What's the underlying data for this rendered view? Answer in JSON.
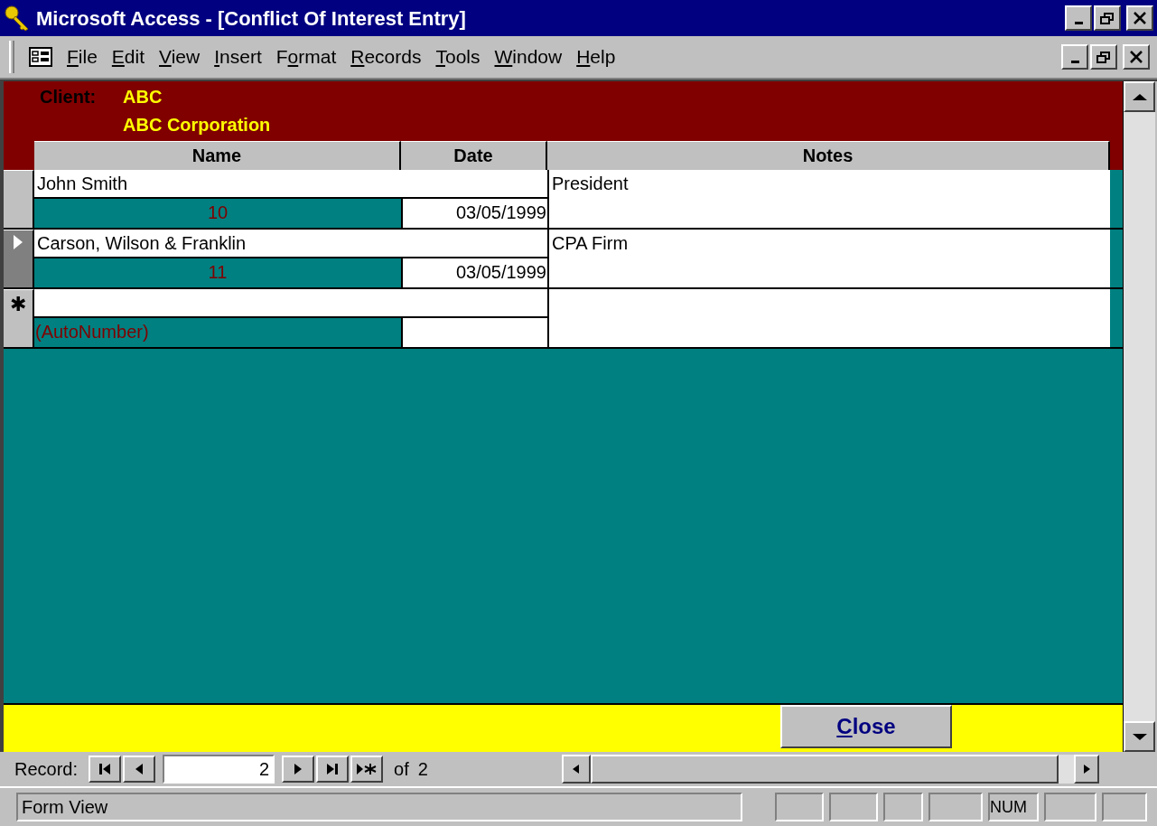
{
  "window": {
    "title": "Microsoft Access - [Conflict Of Interest Entry]"
  },
  "menu": [
    {
      "key": "F",
      "rest": "ile"
    },
    {
      "key": "E",
      "rest": "dit"
    },
    {
      "key": "V",
      "rest": "iew"
    },
    {
      "key": "I",
      "rest": "nsert"
    },
    {
      "pre": "F",
      "key": "o",
      "rest": "rmat"
    },
    {
      "key": "R",
      "rest": "ecords"
    },
    {
      "key": "T",
      "rest": "ools"
    },
    {
      "key": "W",
      "rest": "indow"
    },
    {
      "key": "H",
      "rest": "elp"
    }
  ],
  "form_header": {
    "client_label": "Client:",
    "client_code": "ABC",
    "client_name": "ABC Corporation"
  },
  "columns": [
    "Name",
    "Date",
    "Notes"
  ],
  "records": [
    {
      "kind": "record",
      "selected": false,
      "name": "John Smith",
      "id": "10",
      "date": "03/05/1999",
      "notes": "President"
    },
    {
      "kind": "record",
      "selected": true,
      "name": "Carson, Wilson & Franklin",
      "id": "11",
      "date": "03/05/1999",
      "notes": "CPA Firm"
    },
    {
      "kind": "new",
      "selected": false,
      "selector": "✱",
      "id": "(AutoNumber)"
    }
  ],
  "close_button": {
    "key": "C",
    "rest": "lose"
  },
  "navigator": {
    "label": "Record:",
    "current": "2",
    "of_label": "of",
    "total": "2"
  },
  "status_bar": {
    "text": "Form View",
    "indicators": [
      "NUM"
    ]
  }
}
